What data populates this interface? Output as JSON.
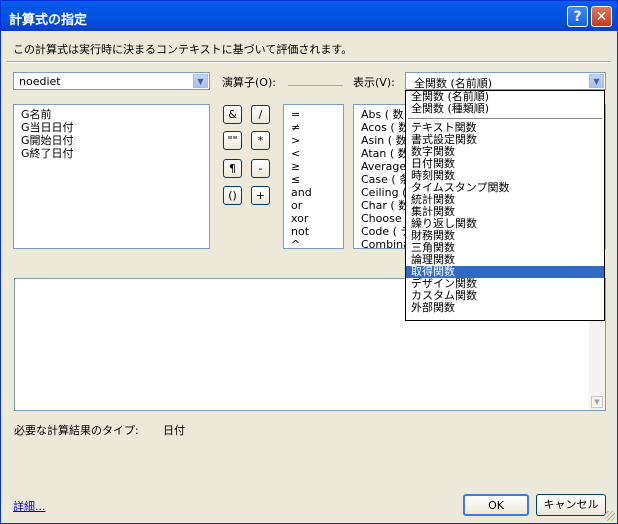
{
  "window": {
    "title": "計算式の指定",
    "help": "?",
    "close": "✕"
  },
  "description": "この計算式は実行時に決まるコンテキストに基づいて評価されます。",
  "context_combo": {
    "value": "noediet"
  },
  "operators_label": "演算子(O):",
  "display_label": "表示(V):",
  "display_combo": {
    "value": "全関数 (名前順)"
  },
  "fields": [
    "G名前",
    "G当日日付",
    "G開始日付",
    "G終了日付"
  ],
  "operator_buttons": [
    "&",
    "/",
    "\"\"",
    "*",
    "¶",
    "-",
    "()",
    "+"
  ],
  "operator_list": [
    "=",
    "≠",
    ">",
    "<",
    "≥",
    "≤",
    "and",
    "or",
    "xor",
    "not",
    "^"
  ],
  "functions_partial": [
    "Abs ( 数",
    "Acos ( 数",
    "Asin ( 数",
    "Atan ( 数",
    "Average",
    "Case ( 条",
    "Ceiling (",
    "Char ( 数",
    "Choose",
    "Code ( テ",
    "Combina"
  ],
  "dropdown_top": [
    "全関数 (名前順)",
    "全関数 (種類順)"
  ],
  "dropdown_items": [
    "テキスト関数",
    "書式設定関数",
    "数字関数",
    "日付関数",
    "時刻関数",
    "タイムスタンプ関数",
    "統計関数",
    "集計関数",
    "繰り返し関数",
    "財務関数",
    "三角関数",
    "論理関数",
    "取得関数",
    "デザイン関数",
    "カスタム関数",
    "外部関数"
  ],
  "selected_dropdown_item": "取得関数",
  "result_type_label": "必要な計算結果のタイプ:",
  "result_type_value": "日付",
  "details_link": "詳細...",
  "ok_label": "OK",
  "cancel_label": "キャンセル"
}
